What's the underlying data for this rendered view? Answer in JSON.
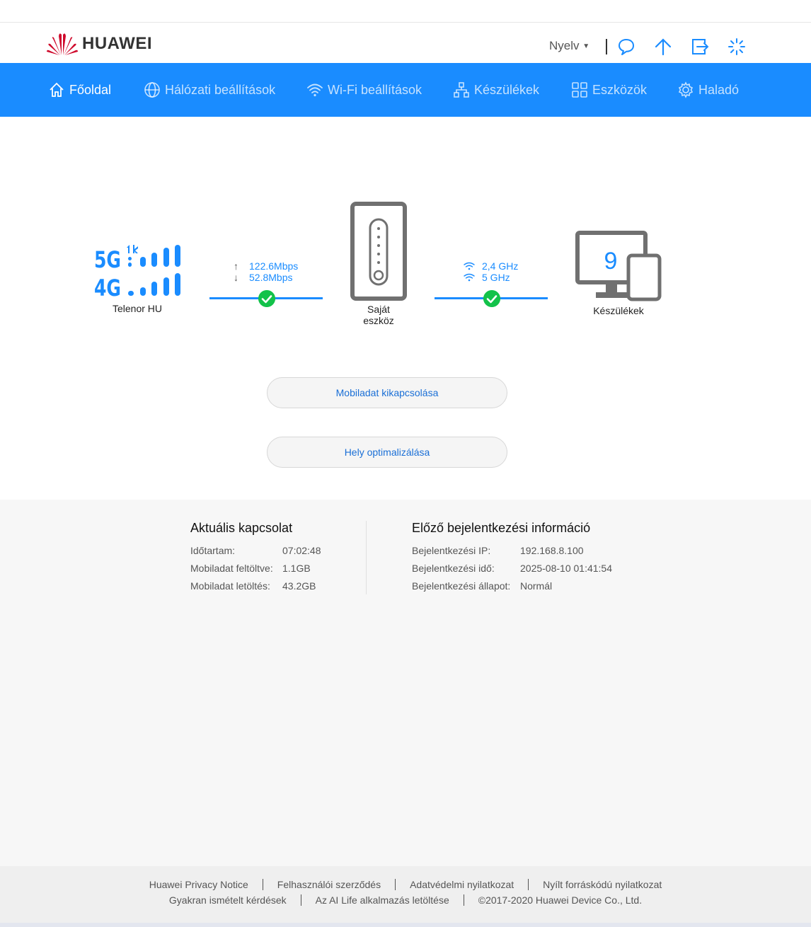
{
  "header": {
    "brand": "HUAWEI",
    "language_label": "Nyelv"
  },
  "nav": {
    "items": [
      {
        "label": "Főoldal",
        "icon": "home-icon",
        "active": true
      },
      {
        "label": "Hálózati beállítások",
        "icon": "globe-icon",
        "active": false
      },
      {
        "label": "Wi-Fi beállítások",
        "icon": "wifi-icon",
        "active": false
      },
      {
        "label": "Készülékek",
        "icon": "network-topology-icon",
        "active": false
      },
      {
        "label": "Eszközök",
        "icon": "grid-icon",
        "active": false
      },
      {
        "label": "Haladó",
        "icon": "gear-icon",
        "active": false
      }
    ]
  },
  "status": {
    "network_badges": [
      "5G",
      "4G"
    ],
    "operator": "Telenor HU",
    "upload_speed": "122.6Mbps",
    "download_speed": "52.8Mbps",
    "device_label_line1": "Saját",
    "device_label_line2": "eszköz",
    "wifi_band_1": "2,4 GHz",
    "wifi_band_2": "5 GHz",
    "connected_devices_count": "9",
    "devices_label": "Készülékek"
  },
  "actions": {
    "mobile_data_off": "Mobiladat kikapcsolása",
    "location_optimize": "Hely optimalizálása"
  },
  "current_connection": {
    "title": "Aktuális kapcsolat",
    "rows": [
      {
        "label": "Időtartam:",
        "value": "07:02:48"
      },
      {
        "label": "Mobiladat feltöltve:",
        "value": "1.1GB"
      },
      {
        "label": "Mobiladat letöltés:",
        "value": "43.2GB"
      }
    ]
  },
  "last_login": {
    "title": "Előző bejelentkezési információ",
    "rows": [
      {
        "label": "Bejelentkezési IP:",
        "value": "192.168.8.100"
      },
      {
        "label": "Bejelentkezési idő:",
        "value": "2025-08-10 01:41:54"
      },
      {
        "label": "Bejelentkezési állapot:",
        "value": "Normál"
      }
    ]
  },
  "footer": {
    "row1": [
      "Huawei Privacy Notice",
      "Felhasználói szerződés",
      "Adatvédelmi nyilatkozat",
      "Nyílt forráskódú nyilatkozat"
    ],
    "row2": [
      "Gyakran ismételt kérdések",
      "Az AI Life alkalmazás letöltése",
      "©2017-2020 Huawei Device Co., Ltd."
    ]
  },
  "colors": {
    "nav_bg": "#1a8cff",
    "accent": "#1a8cff",
    "check": "#13c24a",
    "brand_red": "#cf0a2c"
  }
}
